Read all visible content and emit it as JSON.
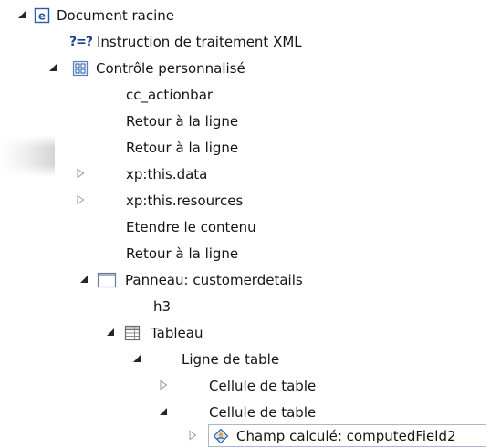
{
  "tree": {
    "rows": [
      {
        "label": "Document racine",
        "icon": "element-e-icon",
        "expander": "expanded"
      },
      {
        "label": "Instruction de traitement XML",
        "icon": "processing-instruction-icon",
        "icon_glyph": "?=?",
        "expander": "none"
      },
      {
        "label": "Contrôle personnalisé",
        "icon": "custom-control-icon",
        "expander": "expanded"
      },
      {
        "label": "cc_actionbar",
        "icon": "",
        "expander": "none"
      },
      {
        "label": "Retour à la ligne",
        "icon": "",
        "expander": "none"
      },
      {
        "label": "Retour à la ligne",
        "icon": "",
        "expander": "none"
      },
      {
        "label": "xp:this.data",
        "icon": "",
        "expander": "collapsed"
      },
      {
        "label": "xp:this.resources",
        "icon": "",
        "expander": "collapsed"
      },
      {
        "label": "Etendre le contenu",
        "icon": "",
        "expander": "none"
      },
      {
        "label": "Retour à la ligne",
        "icon": "",
        "expander": "none"
      },
      {
        "label": "Panneau: customerdetails",
        "icon": "panel-icon",
        "expander": "expanded"
      },
      {
        "label": "h3",
        "icon": "",
        "expander": "none"
      },
      {
        "label": "Tableau",
        "icon": "table-icon",
        "expander": "expanded"
      },
      {
        "label": "Ligne de table",
        "icon": "",
        "expander": "expanded"
      },
      {
        "label": "Cellule de table",
        "icon": "",
        "expander": "collapsed"
      },
      {
        "label": "Cellule de table",
        "icon": "",
        "expander": "expanded"
      },
      {
        "label": "Champ calculé: computedField2",
        "icon": "computed-field-icon",
        "expander": "collapsed"
      }
    ]
  },
  "colors": {
    "text": "#141414",
    "selection_border": "#a9b8cf",
    "expander_fill": "#262626",
    "expander_outline": "#9a9a9a",
    "icon_blue": "#2c5aa8"
  }
}
